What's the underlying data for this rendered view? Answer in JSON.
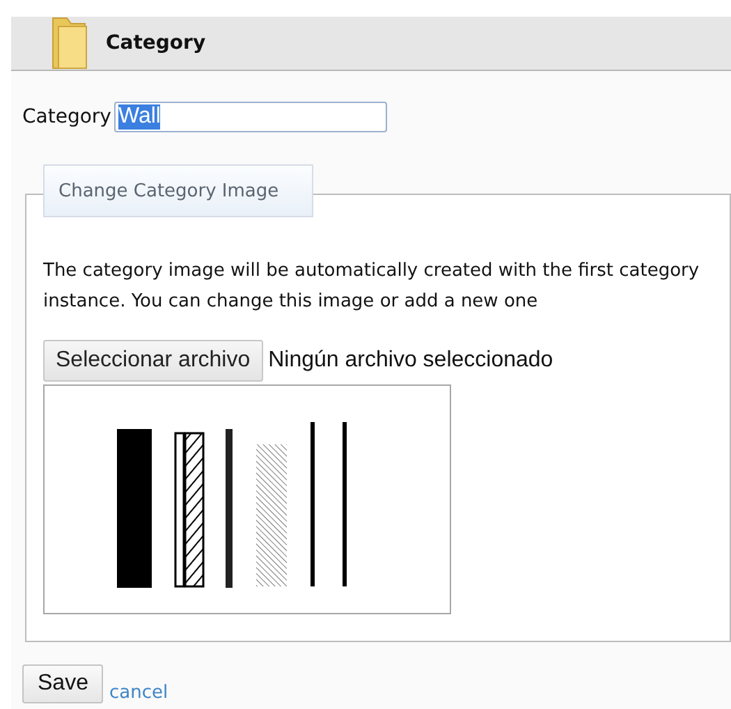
{
  "header": {
    "title": "Category"
  },
  "category_field": {
    "label": "Category",
    "value": "Wall",
    "text_selected": true
  },
  "image_section": {
    "legend": "Change Category Image",
    "description": "The category image will be automatically created with the first category instance. You can change this image or add a new one",
    "file_button": "Seleccionar archivo",
    "file_status": "Ningún archivo seleccionado"
  },
  "actions": {
    "save": "Save",
    "cancel": "cancel"
  }
}
